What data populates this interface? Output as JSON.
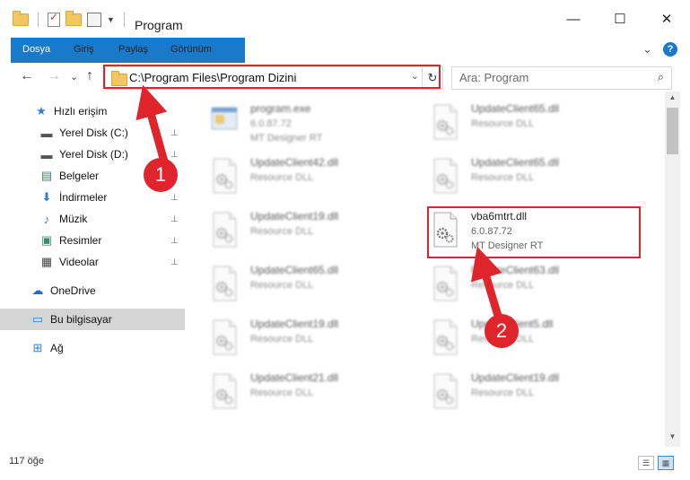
{
  "window": {
    "title": "Program",
    "controls": {
      "minimize": "—",
      "maximize": "☐",
      "close": "✕"
    }
  },
  "ribbon": {
    "tabs": [
      "Dosya",
      "Giriş",
      "Paylaş",
      "Görünüm"
    ],
    "expand": "⌄",
    "help": "?"
  },
  "nav": {
    "back": "←",
    "forward": "→",
    "recent": "⌄",
    "up": "↑",
    "address": "C:\\Program Files\\Program Dizini",
    "address_dropdown": "⌄",
    "refresh": "↻",
    "search_placeholder": "Ara: Program",
    "search_icon": "⌕"
  },
  "sidebar": {
    "items": [
      {
        "label": "Hızlı erişim",
        "icon": "star-icon",
        "glyph": "★",
        "color": "#2f7fd8",
        "pinned": false
      },
      {
        "label": "Yerel Disk (C:)",
        "icon": "drive-icon",
        "glyph": "▬",
        "color": "#555555",
        "pinned": true
      },
      {
        "label": "Yerel Disk (D:)",
        "icon": "drive-icon",
        "glyph": "▬",
        "color": "#555555",
        "pinned": true
      },
      {
        "label": "Belgeler",
        "icon": "documents-icon",
        "glyph": "▤",
        "color": "#4a6fa5",
        "pinned": true
      },
      {
        "label": "İndirmeler",
        "icon": "download-icon",
        "glyph": "⬇",
        "color": "#2f7fd8",
        "pinned": true
      },
      {
        "label": "Müzik",
        "icon": "music-icon",
        "glyph": "♪",
        "color": "#2f7fd8",
        "pinned": true
      },
      {
        "label": "Resimler",
        "icon": "pictures-icon",
        "glyph": "▣",
        "color": "#3a8a6e",
        "pinned": true
      },
      {
        "label": "Videolar",
        "icon": "video-icon",
        "glyph": "▦",
        "color": "#444444",
        "pinned": true
      },
      {
        "label": "OneDrive",
        "icon": "cloud-icon",
        "glyph": "☁",
        "color": "#1f6fc5",
        "pinned": false
      },
      {
        "label": "Bu bilgisayar",
        "icon": "computer-icon",
        "glyph": "▭",
        "color": "#2f7fd8",
        "pinned": false,
        "selected": true
      },
      {
        "label": "Ağ",
        "icon": "network-icon",
        "glyph": "⊞",
        "color": "#2f7fd8",
        "pinned": false
      }
    ],
    "pin_glyph": "📌"
  },
  "files": [
    {
      "name": "program.exe",
      "version": "6.0.87.72",
      "desc": "MT Designer RT",
      "blurred": true,
      "type": "exe"
    },
    {
      "name": "UpdateClient65.dll",
      "version": "",
      "desc": "Resource DLL",
      "blurred": true,
      "type": "dll"
    },
    {
      "name": "UpdateClient42.dll",
      "version": "",
      "desc": "Resource DLL",
      "blurred": true,
      "type": "dll"
    },
    {
      "name": "UpdateClient65.dll",
      "version": "",
      "desc": "Resource DLL",
      "blurred": true,
      "type": "dll"
    },
    {
      "name": "UpdateClient19.dll",
      "version": "",
      "desc": "Resource DLL",
      "blurred": true,
      "type": "dll"
    },
    {
      "name": "vba6mtrt.dll",
      "version": "6.0.87.72",
      "desc": "MT Designer RT",
      "blurred": false,
      "type": "dll"
    },
    {
      "name": "UpdateClient65.dll",
      "version": "",
      "desc": "Resource DLL",
      "blurred": true,
      "type": "dll"
    },
    {
      "name": "UpdateClient63.dll",
      "version": "",
      "desc": "Resource DLL",
      "blurred": true,
      "type": "dll"
    },
    {
      "name": "UpdateClient19.dll",
      "version": "",
      "desc": "Resource DLL",
      "blurred": true,
      "type": "dll"
    },
    {
      "name": "UpdateClient5.dll",
      "version": "",
      "desc": "Resource DLL",
      "blurred": true,
      "type": "dll"
    },
    {
      "name": "UpdateClient21.dll",
      "version": "",
      "desc": "Resource DLL",
      "blurred": true,
      "type": "dll"
    },
    {
      "name": "UpdateClient19.dll",
      "version": "",
      "desc": "Resource DLL",
      "blurred": true,
      "type": "dll"
    }
  ],
  "status": {
    "count": "117 öğe"
  },
  "annotations": {
    "step1": "1",
    "step2": "2",
    "color": "#e0242c"
  }
}
